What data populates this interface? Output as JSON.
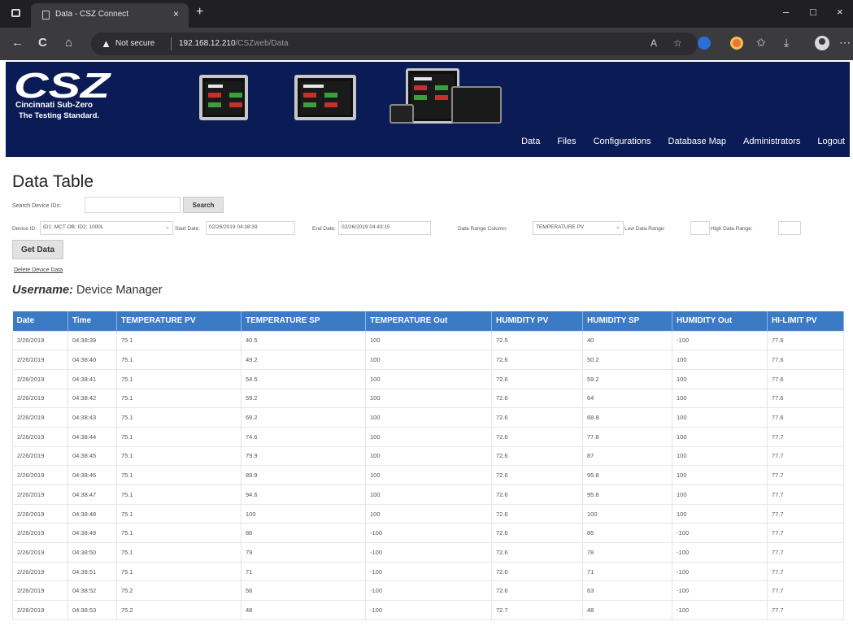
{
  "browser": {
    "tab_title": "Data - CSZ Connect",
    "tab_close": "×",
    "new_tab": "+",
    "not_secure": "Not secure",
    "url_host": "192.168.12.210",
    "url_path": "/CSZweb/Data",
    "window_min": "–",
    "window_max": "□",
    "window_close": "×",
    "back": "←",
    "refresh": "C",
    "home": "⌂",
    "warn": "▲",
    "star": "☆",
    "bookmarks": "✩",
    "download": "⤓",
    "menu": "⋯"
  },
  "site": {
    "logo_text": "CSZ",
    "logo_sub1": "Cincinnati Sub-Zero",
    "logo_sub2": "The Testing Standard.",
    "nav": [
      "Data",
      "Files",
      "Configurations",
      "Database Map",
      "Administrators",
      "Logout"
    ]
  },
  "page": {
    "title": "Data Table",
    "search_label": "Search Device IDs:",
    "search_input_value": "",
    "search_button": "Search",
    "device_id_label": "Device ID:",
    "device_id_value": "ID1: MCT-OB; ID2: 1000L",
    "start_date_label": "Start Date:",
    "start_date_value": "02/26/2019 04:38:39",
    "end_date_label": "End Date:",
    "end_date_value": "02/26/2019 04:43:15",
    "range_column_label": "Data Range Column:",
    "range_column_value": "TEMPERATURE PV",
    "low_range_label": "Low Data Range:",
    "low_range_value": "",
    "high_range_label": "High Data Range:",
    "high_range_value": "",
    "get_data_button": "Get Data",
    "delete_link": "Delete Device Data",
    "username_label": "Username:",
    "username_value": "Device Manager"
  },
  "table": {
    "headers": [
      "Date",
      "Time",
      "TEMPERATURE PV",
      "TEMPERATURE SP",
      "TEMPERATURE Out",
      "HUMIDITY PV",
      "HUMIDITY SP",
      "HUMIDITY Out",
      "HI-LIMIT PV"
    ],
    "rows": [
      [
        "2/26/2019",
        "04:38:39",
        "75.1",
        "40.5",
        "100",
        "72.5",
        "40",
        "-100",
        "77.6"
      ],
      [
        "2/26/2019",
        "04:38:40",
        "75.1",
        "49.2",
        "100",
        "72.6",
        "50.2",
        "100",
        "77.6"
      ],
      [
        "2/26/2019",
        "04:38:41",
        "75.1",
        "54.5",
        "100",
        "72.6",
        "59.2",
        "100",
        "77.6"
      ],
      [
        "2/26/2019",
        "04:38:42",
        "75.1",
        "59.2",
        "100",
        "72.6",
        "64",
        "100",
        "77.6"
      ],
      [
        "2/26/2019",
        "04:38:43",
        "75.1",
        "69.2",
        "100",
        "72.6",
        "68.8",
        "100",
        "77.6"
      ],
      [
        "2/26/2019",
        "04:38:44",
        "75.1",
        "74.6",
        "100",
        "72.6",
        "77.8",
        "100",
        "77.7"
      ],
      [
        "2/26/2019",
        "04:38:45",
        "75.1",
        "79.9",
        "100",
        "72.6",
        "87",
        "100",
        "77.7"
      ],
      [
        "2/26/2019",
        "04:38:46",
        "75.1",
        "89.9",
        "100",
        "72.6",
        "95.8",
        "100",
        "77.7"
      ],
      [
        "2/26/2019",
        "04:38:47",
        "75.1",
        "94.6",
        "100",
        "72.6",
        "95.8",
        "100",
        "77.7"
      ],
      [
        "2/26/2019",
        "04:38:48",
        "75.1",
        "100",
        "100",
        "72.6",
        "100",
        "100",
        "77.7"
      ],
      [
        "2/26/2019",
        "04:38:49",
        "75.1",
        "86",
        "-100",
        "72.6",
        "85",
        "-100",
        "77.7"
      ],
      [
        "2/26/2019",
        "04:38:50",
        "75.1",
        "79",
        "-100",
        "72.6",
        "78",
        "-100",
        "77.7"
      ],
      [
        "2/26/2019",
        "04:38:51",
        "75.1",
        "71",
        "-100",
        "72.6",
        "71",
        "-100",
        "77.7"
      ],
      [
        "2/26/2019",
        "04:38:52",
        "75.2",
        "56",
        "-100",
        "72.6",
        "63",
        "-100",
        "77.7"
      ],
      [
        "2/26/2019",
        "04:38:53",
        "75.2",
        "48",
        "-100",
        "72.7",
        "48",
        "-100",
        "77.7"
      ]
    ]
  },
  "colors": {
    "banner_bg": "#0b1b55",
    "table_header_bg": "#3b7bc6",
    "browser_dark": "#1f1f24",
    "browser_toolbar": "#3a3a3f"
  }
}
